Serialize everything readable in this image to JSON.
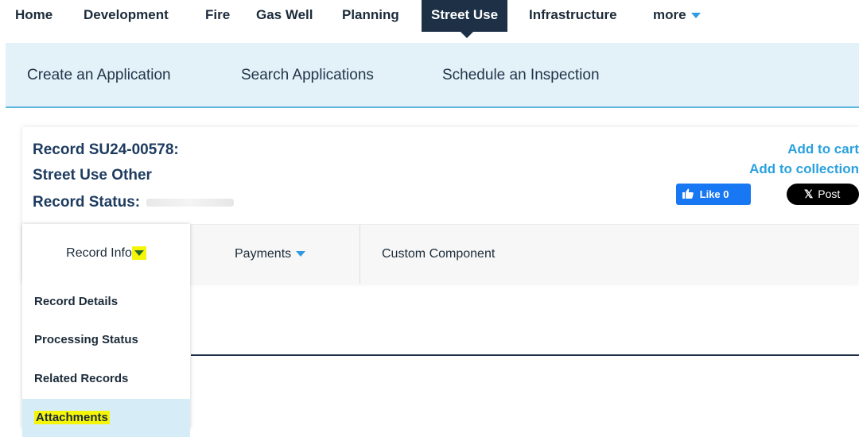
{
  "topnav": {
    "items": [
      "Home",
      "Development",
      "Fire",
      "Gas Well",
      "Planning",
      "Street Use",
      "Infrastructure",
      "more"
    ],
    "active": "Street Use"
  },
  "subnav": {
    "links": [
      "Create an Application",
      "Search Applications",
      "Schedule an Inspection"
    ]
  },
  "record": {
    "id_line": "Record SU24-00578:",
    "type_line": "Street Use Other",
    "status_label": "Record Status:",
    "add_to_cart": "Add to cart",
    "add_to_collection": "Add to collection",
    "fb_like": "Like 0",
    "x_post": "Post"
  },
  "tabs": {
    "record_info": "Record Info",
    "payments": "Payments",
    "custom_component": "Custom Component"
  },
  "dropdown": {
    "items": [
      "Record Details",
      "Processing Status",
      "Related Records",
      "Attachments"
    ],
    "selected": "Attachments"
  },
  "colors": {
    "nav_active": "#1d3045",
    "subnav_bg": "#e3f1f8",
    "link_blue": "#2aa1df",
    "highlight": "#f5f50a"
  }
}
